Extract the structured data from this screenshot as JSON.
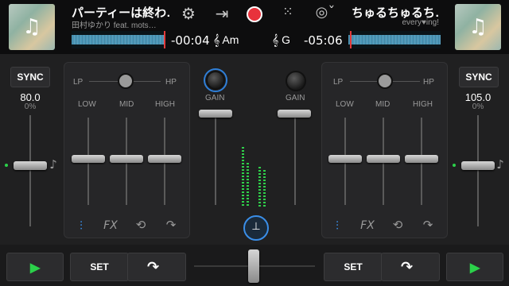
{
  "deck_left": {
    "title": "パーティーは終わ…",
    "artist": "田村ゆかり feat. mots…",
    "time": "-00:04",
    "key": "Am",
    "sync_label": "SYNC",
    "bpm": "80.0",
    "pitch": "0%",
    "tempo_fraction": 0.5
  },
  "deck_right": {
    "title": "ちゅるちゅるち…",
    "artist": "every♥ing!",
    "time": "-05:06",
    "key": "G",
    "sync_label": "SYNC",
    "bpm": "105.0",
    "pitch": "0%",
    "tempo_fraction": 0.5
  },
  "mixer": {
    "lp_label": "LP",
    "hp_label": "HP",
    "low_label": "LOW",
    "mid_label": "MID",
    "high_label": "HIGH",
    "gain_label": "GAIN",
    "fx_label": "FX"
  },
  "bottom": {
    "set_label_left": "SET",
    "set_label_right": "SET",
    "crossfader_position": 0.5
  },
  "icons": {
    "music": "music-note-icon",
    "settings": "gear-icon",
    "record": "record-icon"
  },
  "colors": {
    "accent_blue": "#3a8ee8",
    "play_green": "#2bd14a",
    "record_red": "#e8323c",
    "meter_green": "#2fd04a"
  }
}
